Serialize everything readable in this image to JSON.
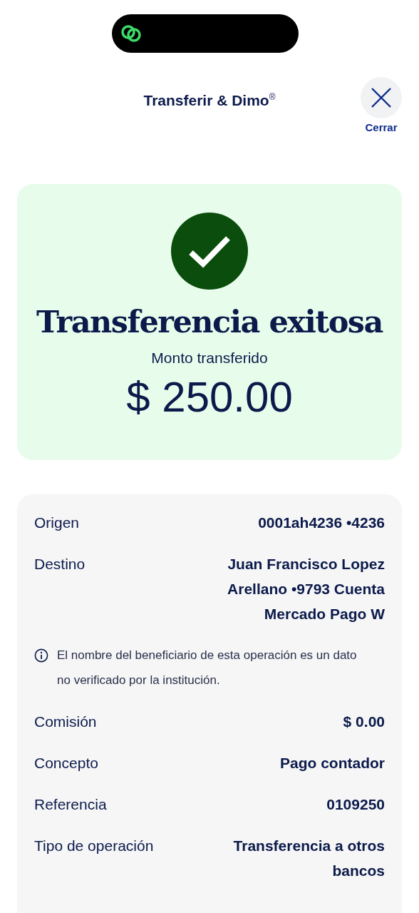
{
  "header": {
    "title": "Transferir & Dimo$^{®}$",
    "close_label": "Cerrar"
  },
  "result": {
    "title": "Transferencia exitosa",
    "amount_label": "Monto transferido",
    "amount": "$ 250.00"
  },
  "details": [
    {
      "kind": "row",
      "label": "Origen",
      "value": "0001ah4236 •4236"
    },
    {
      "kind": "row",
      "label": "Destino",
      "value": "Juan Francisco Lopez Arellano •9793 Cuenta Mercado Pago W"
    },
    {
      "kind": "notice",
      "text": "El nombre del beneficiario de esta operación es un dato no verificado por la institución."
    },
    {
      "kind": "row",
      "label": "Comisión",
      "value": "$ 0.00"
    },
    {
      "kind": "row",
      "label": "Concepto",
      "value": "Pago contador"
    },
    {
      "kind": "row",
      "label": "Referencia",
      "value": "0109250"
    },
    {
      "kind": "row",
      "label": "Tipo de operación",
      "value": "Transferencia a otros bancos"
    }
  ]
}
